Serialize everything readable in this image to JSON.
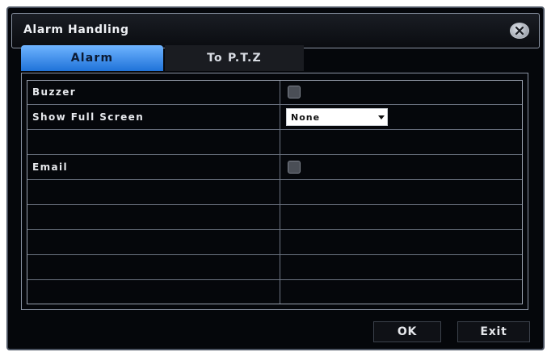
{
  "window": {
    "title": "Alarm Handling",
    "close_icon": "close-icon"
  },
  "tabs": [
    {
      "label": "Alarm",
      "active": true
    },
    {
      "label": "To P.T.Z",
      "active": false
    }
  ],
  "rows": [
    {
      "label": "Buzzer",
      "control": "checkbox",
      "checked": false
    },
    {
      "label": "Show Full Screen",
      "control": "select",
      "value": "None"
    },
    {
      "label": "",
      "control": "none"
    },
    {
      "label": "Email",
      "control": "checkbox",
      "checked": false
    },
    {
      "label": "",
      "control": "none"
    },
    {
      "label": "",
      "control": "none"
    },
    {
      "label": "",
      "control": "none"
    },
    {
      "label": "",
      "control": "none"
    },
    {
      "label": "",
      "control": "none"
    }
  ],
  "buttons": {
    "ok_label": "OK",
    "exit_label": "Exit"
  },
  "colors": {
    "active_tab": "#1f73d9",
    "background": "#05070b"
  }
}
